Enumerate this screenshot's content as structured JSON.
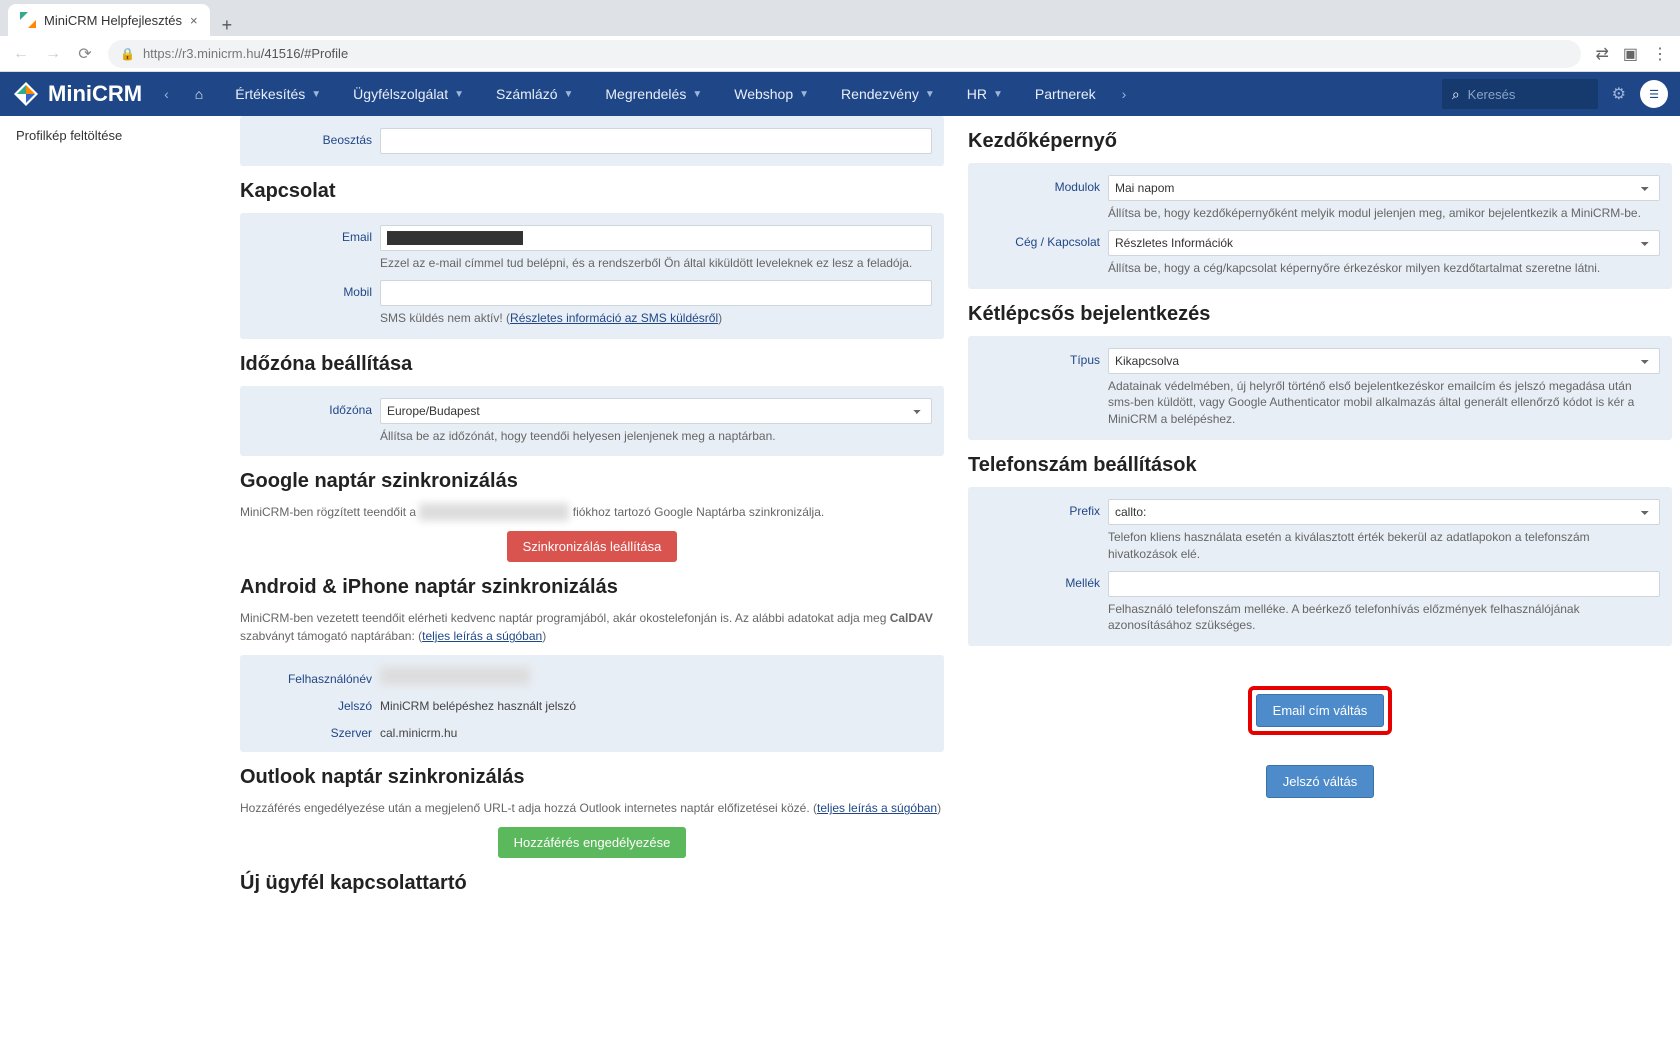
{
  "browser": {
    "tab_title": "MiniCRM Helpfejlesztés",
    "url_host": "https://r3.minicrm.hu",
    "url_path": "/41516/#Profile"
  },
  "logo_text": "MiniCRM",
  "nav_items": [
    "Értékesítés",
    "Ügyfélszolgálat",
    "Számlázó",
    "Megrendelés",
    "Webshop",
    "Rendezvény",
    "HR",
    "Partnerek"
  ],
  "search_placeholder": "Keresés",
  "sidebar": {
    "profile_upload": "Profilkép feltöltése"
  },
  "left": {
    "beosztas_label": "Beosztás",
    "kapcsolat_title": "Kapcsolat",
    "email_label": "Email",
    "email_help": "Ezzel az e-mail címmel tud belépni, és a rendszerből Ön által kiküldött leveleknek ez lesz a feladója.",
    "mobil_label": "Mobil",
    "sms_help_pre": "SMS küldés nem aktív!  (",
    "sms_link": "Részletes információ az SMS küldésről",
    "sms_help_post": ")",
    "tz_title": "Időzóna beállítása",
    "tz_label": "Időzóna",
    "tz_value": "Europe/Budapest",
    "tz_help": "Állítsa be az időzónát, hogy teendői helyesen jelenjenek meg a naptárban.",
    "gcal_title": "Google naptár szinkronizálás",
    "gcal_desc_pre": "MiniCRM-ben rögzített teendőit a ",
    "gcal_desc_post": " fiókhoz tartozó Google Naptárba szinkronizálja.",
    "gcal_btn": "Szinkronizálás leállítása",
    "mobile_title": "Android & iPhone naptár szinkronizálás",
    "mobile_desc_pre": "MiniCRM-ben vezetett teendőit elérheti kedvenc naptár programjából, akár okostelefonján is. Az alábbi adatokat adja meg ",
    "mobile_caldav": "CalDAV",
    "mobile_desc_mid": " szabványt támogató naptárában: (",
    "mobile_link": "teljes leírás a súgóban",
    "mobile_desc_post": ")",
    "user_label": "Felhasználónév",
    "pw_label": "Jelszó",
    "pw_value": "MiniCRM belépéshez használt jelszó",
    "server_label": "Szerver",
    "server_value": "cal.minicrm.hu",
    "outlook_title": "Outlook naptár szinkronizálás",
    "outlook_desc_pre": "Hozzáférés engedélyezése után a megjelenő URL-t adja hozzá Outlook internetes naptár előfizetései közé. (",
    "outlook_link": "teljes leírás a súgóban",
    "outlook_desc_post": ")",
    "outlook_btn": "Hozzáférés engedélyezése",
    "ujugyfel_title": "Új ügyfél kapcsolattartó"
  },
  "right": {
    "home_title": "Kezdőképernyő",
    "modulok_label": "Modulok",
    "modulok_value": "Mai napom",
    "modulok_help": "Állítsa be, hogy kezdőképernyőként melyik modul jelenjen meg, amikor bejelentkezik a MiniCRM-be.",
    "ceg_label": "Cég / Kapcsolat",
    "ceg_value": "Részletes Információk",
    "ceg_help": "Állítsa be, hogy a cég/kapcsolat képernyőre érkezéskor milyen kezdőtartalmat szeretne látni.",
    "twofa_title": "Kétlépcsős bejelentkezés",
    "tipus_label": "Típus",
    "tipus_value": "Kikapcsolva",
    "tipus_help": "Adatainak védelmében, új helyről történő első bejelentkezéskor emailcím és jelszó megadása után sms-ben küldött, vagy Google Authenticator mobil alkalmazás által generált ellenőrző kódot is kér a MiniCRM a belépéshez.",
    "phone_title": "Telefonszám beállítások",
    "prefix_label": "Prefix",
    "prefix_value": "callto:",
    "prefix_help": "Telefon kliens használata esetén a kiválasztott érték bekerül az adatlapokon a telefonszám hivatkozások elé.",
    "mellek_label": "Mellék",
    "mellek_help": "Felhasználó telefonszám melléke. A beérkező telefonhívás előzmények felhasználójának azonosításához szükséges.",
    "email_btn": "Email cím váltás",
    "pw_btn": "Jelszó váltás"
  }
}
